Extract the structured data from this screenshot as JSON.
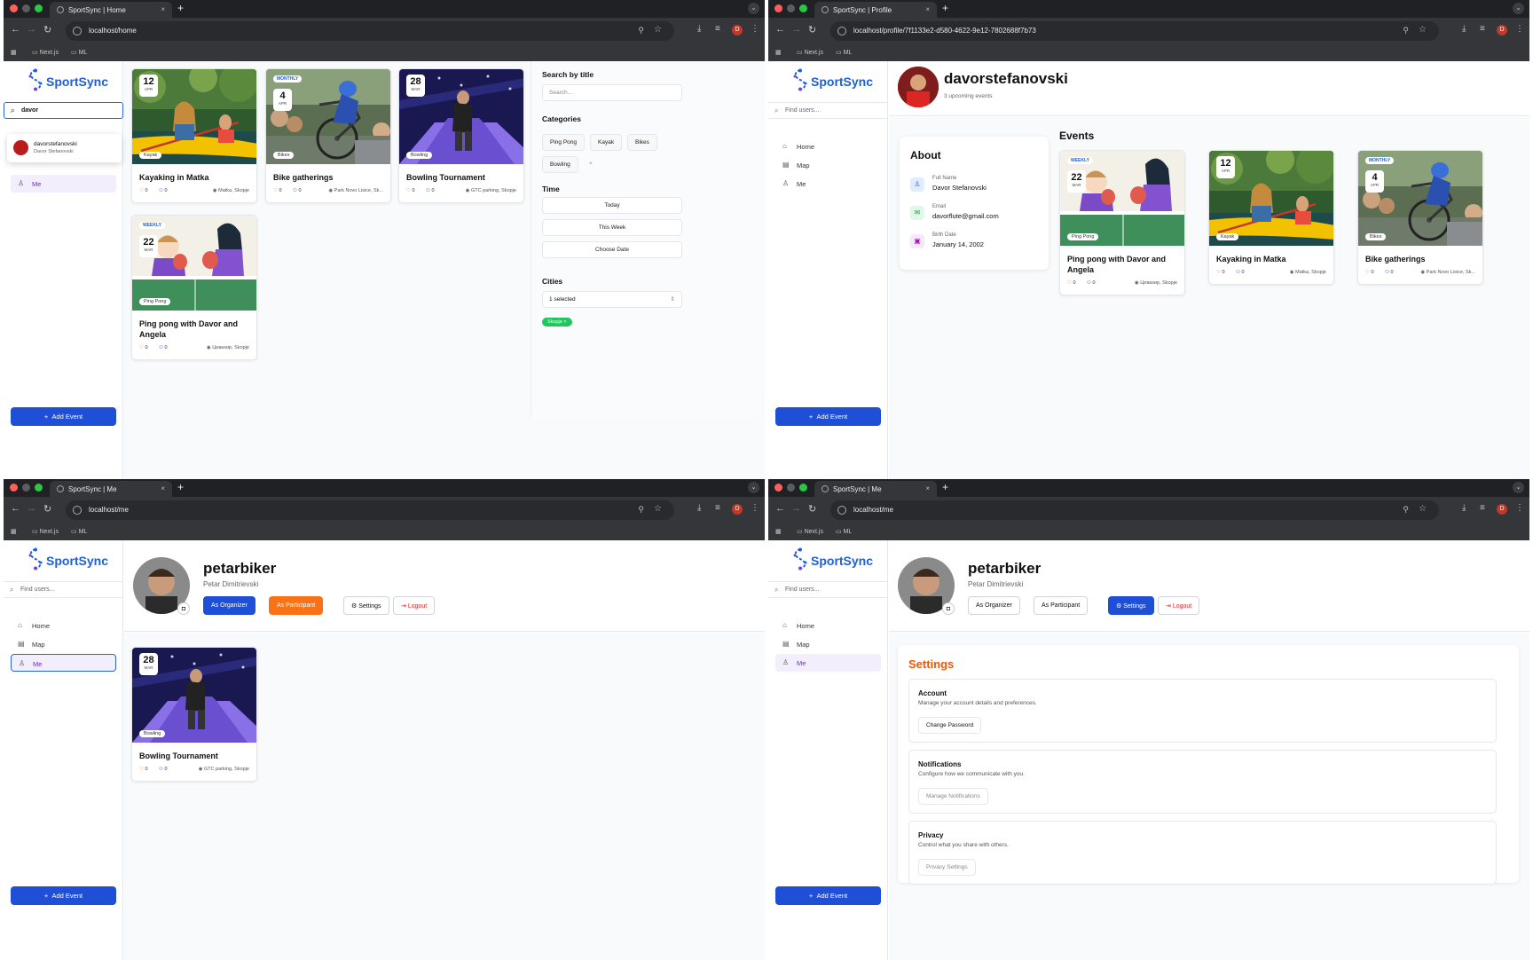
{
  "brand": {
    "name": "SportSync",
    "accent": "#1f5fd8",
    "action": "#1e4fd6",
    "orange": "#f97316"
  },
  "browser": {
    "bookmarks": [
      "Next.js",
      "ML"
    ],
    "profile_initial": "D",
    "new_tab_label": "+"
  },
  "windows": [
    {
      "tab_title": "SportSync | Home",
      "url": "localhost/home"
    },
    {
      "tab_title": "SportSync | Profile",
      "url": "localhost/profile/7f1133e2-d580-4622-9e12-7802688f7b73"
    },
    {
      "tab_title": "SportSync | Me",
      "url": "localhost/me"
    },
    {
      "tab_title": "SportSync | Me",
      "url": "localhost/me"
    }
  ],
  "sidebar": {
    "find_placeholder": "Find users...",
    "items": [
      {
        "label": "Home",
        "icon": "home-icon"
      },
      {
        "label": "Map",
        "icon": "map-icon"
      },
      {
        "label": "Me",
        "icon": "user-icon"
      }
    ],
    "add_event": "Add Event",
    "map_partial": "Map"
  },
  "home": {
    "search_value": "davor",
    "dropdown_user": {
      "username": "davorstefanovski",
      "full_name": "Davor Stefanovski"
    },
    "events": [
      {
        "day": "12",
        "month": "APR",
        "recurrence": "",
        "category": "Kayak",
        "title": "Kayaking in Matka",
        "likes": "0",
        "participants": "0",
        "location": "Matka, Skopje"
      },
      {
        "day": "4",
        "month": "APR",
        "recurrence": "MONTHLY",
        "category": "Bikes",
        "title": "Bike gatherings",
        "likes": "0",
        "participants": "0",
        "location": "Park Novo Lisice, Sk..."
      },
      {
        "day": "28",
        "month": "MAR",
        "recurrence": "",
        "category": "Bowling",
        "title": "Bowling Tournament",
        "likes": "0",
        "participants": "0",
        "location": "GTC parking, Skopje"
      },
      {
        "day": "22",
        "month": "MAR",
        "recurrence": "WEEKLY",
        "category": "Ping Pong",
        "title": "Ping pong with Davor and Angela",
        "likes": "0",
        "participants": "0",
        "location": "Цевахир, Skopje"
      }
    ],
    "filters": {
      "search_title": "Search by title",
      "search_placeholder": "Search...",
      "categories_title": "Categories",
      "categories": [
        "Ping Pong",
        "Kayak",
        "Bikes",
        "Bowling"
      ],
      "add_symbol": "+",
      "time_title": "Time",
      "time_options": [
        "Today",
        "This Week",
        "Choose Date"
      ],
      "cities_title": "Cities",
      "cities_value": "1 selected",
      "city_chip": "Skopje ×"
    }
  },
  "profile": {
    "username": "davorstefanovski",
    "upcoming": "3 upcoming events",
    "about_title": "About",
    "fields": [
      {
        "label": "Full Name",
        "value": "Davor Stefanovski",
        "icon": "user-icon"
      },
      {
        "label": "Email",
        "value": "davorflute@gmail.com",
        "icon": "mail-icon"
      },
      {
        "label": "Birth Date",
        "value": "January 14, 2002",
        "icon": "calendar-icon"
      }
    ],
    "events_title": "Events",
    "events": [
      {
        "day": "22",
        "month": "MAR",
        "recurrence": "WEEKLY",
        "category": "Ping Pong",
        "title": "Ping pong with Davor and Angela",
        "likes": "0",
        "participants": "0",
        "location": "Цевахир, Skopje"
      },
      {
        "day": "12",
        "month": "APR",
        "recurrence": "",
        "category": "Kayak",
        "title": "Kayaking in Matka",
        "likes": "0",
        "participants": "0",
        "location": "Matka, Skopje"
      },
      {
        "day": "4",
        "month": "APR",
        "recurrence": "MONTHLY",
        "category": "Bikes",
        "title": "Bike gatherings",
        "likes": "0",
        "participants": "0",
        "location": "Park Novo Lisice, Sk..."
      }
    ]
  },
  "me": {
    "username": "petarbiker",
    "full_name": "Petar Dimitrievski",
    "buttons": {
      "organizer": "As Organizer",
      "participant": "As Participant",
      "settings": "Settings",
      "logout": "Logout"
    },
    "event": {
      "day": "28",
      "month": "MAR",
      "category": "Bowling",
      "title": "Bowling Tournament",
      "likes": "0",
      "participants": "0",
      "location": "GTC parking, Skopje"
    }
  },
  "settings": {
    "title": "Settings",
    "sections": [
      {
        "title": "Account",
        "desc": "Manage your account details and preferences.",
        "button": "Change Password"
      },
      {
        "title": "Notifications",
        "desc": "Configure how we communicate with you.",
        "button": "Manage Notifications"
      },
      {
        "title": "Privacy",
        "desc": "Control what you share with others.",
        "button": "Privacy Settings"
      }
    ]
  }
}
